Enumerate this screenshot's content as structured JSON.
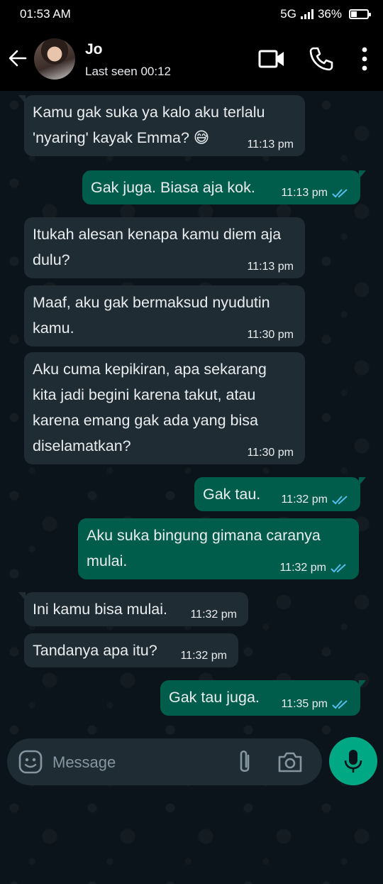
{
  "status_bar": {
    "time": "01:53 AM",
    "network": "5G",
    "battery": "36%"
  },
  "header": {
    "name": "Jo",
    "last_seen": "Last seen 00:12"
  },
  "messages": [
    {
      "dir": "in",
      "text": "Kamu gak suka ya kalo aku terlalu\n'nyaring' kayak Emma? 😅",
      "time": "11:13 pm"
    },
    {
      "dir": "out",
      "text": "Gak juga. Biasa aja kok.",
      "time": "11:13 pm",
      "read": true
    },
    {
      "dir": "in",
      "text": "Itukah alesan kenapa kamu diem aja\ndulu?",
      "time": "11:13 pm"
    },
    {
      "dir": "in",
      "text": "Maaf, aku gak bermaksud nyudutin\nkamu.",
      "time": "11:30 pm"
    },
    {
      "dir": "in",
      "text": "Aku cuma kepikiran, apa sekarang\nkita jadi begini karena takut, atau\nkarena emang gak ada yang bisa\ndiselamatkan?",
      "time": "11:30 pm"
    },
    {
      "dir": "out",
      "text": "Gak tau.",
      "time": "11:32 pm",
      "read": true
    },
    {
      "dir": "out",
      "text": "Aku suka bingung gimana caranya\nmulai.",
      "time": "11:32 pm",
      "read": true
    },
    {
      "dir": "in",
      "text": "Ini kamu bisa mulai.",
      "time": "11:32 pm"
    },
    {
      "dir": "in",
      "text": "Tandanya apa itu?",
      "time": "11:32 pm"
    },
    {
      "dir": "out",
      "text": "Gak tau juga.",
      "time": "11:35 pm",
      "read": true
    }
  ],
  "composer": {
    "placeholder": "Message"
  },
  "colors": {
    "incoming": "#202c33",
    "outgoing": "#005c4b",
    "accent": "#00a884",
    "read_ticks": "#53bdeb"
  }
}
